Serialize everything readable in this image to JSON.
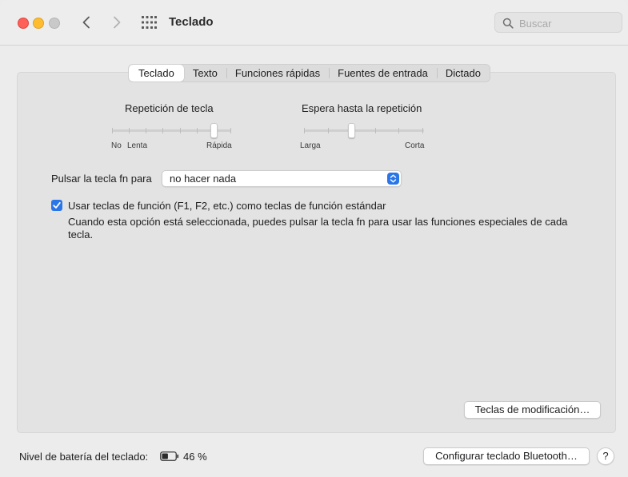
{
  "window": {
    "title": "Teclado",
    "search": {
      "placeholder": "Buscar",
      "value": ""
    }
  },
  "tabs": [
    {
      "label": "Teclado",
      "active": true
    },
    {
      "label": "Texto",
      "active": false
    },
    {
      "label": "Funciones rápidas",
      "active": false
    },
    {
      "label": "Fuentes de entrada",
      "active": false
    },
    {
      "label": "Dictado",
      "active": false
    }
  ],
  "key_repeat": {
    "label": "Repetición de tecla",
    "min_label": "No",
    "low_label": "Lenta",
    "high_label": "Rápida",
    "value_fraction": 0.86
  },
  "delay_until_repeat": {
    "label": "Espera hasta la repetición",
    "low_label": "Larga",
    "high_label": "Corta",
    "value_fraction": 0.4
  },
  "fn_key": {
    "label": "Pulsar la tecla fn para",
    "selected": "no hacer nada"
  },
  "function_keys": {
    "checked": true,
    "label": "Usar teclas de función (F1, F2, etc.) como teclas de función estándar",
    "description": "Cuando esta opción está seleccionada, puedes pulsar la tecla fn para usar las funciones especiales de cada tecla."
  },
  "buttons": {
    "modifier_keys": "Teclas de modificación…",
    "bluetooth_setup": "Configurar teclado Bluetooth…",
    "help": "?"
  },
  "battery": {
    "label": "Nivel de batería del teclado:",
    "percent_text": "46 %",
    "level": 0.46
  },
  "colors": {
    "accent": "#2a76e8",
    "close": "#fe5f57",
    "minimize": "#febc2e",
    "maximize_inactive": "#c9c9c9"
  }
}
